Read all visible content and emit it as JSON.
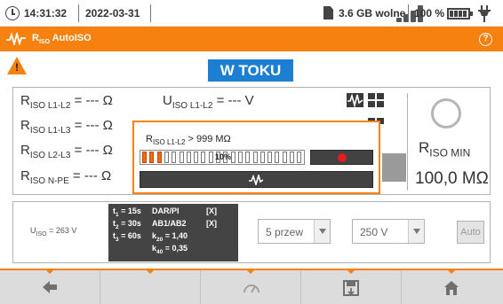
{
  "status_bar": {
    "time": "14:31:32",
    "date": "2022-03-31",
    "storage": "3.6 GB wolne",
    "battery": "100 %"
  },
  "title_bar": {
    "title_main": "R",
    "title_sub": "ISO",
    "title_rest": " AutoISO"
  },
  "status": {
    "label": "W TOKU"
  },
  "measurements": [
    {
      "r_main": "R",
      "r_sub": "ISO L1-L2",
      "r_value": " = --- Ω",
      "u_main": "U",
      "u_sub": "ISO L1-L2",
      "u_value": " = --- V"
    },
    {
      "r_main": "R",
      "r_sub": "ISO L1-L3",
      "r_value": " = --- Ω"
    },
    {
      "r_main": "R",
      "r_sub": "ISO L2-L3",
      "r_value": " = --- Ω"
    },
    {
      "r_main": "R",
      "r_sub": "ISO N-PE",
      "r_value": " = --- Ω"
    }
  ],
  "result": {
    "label_main": "R",
    "label_sub": "ISO MIN",
    "value": "100,0 MΩ"
  },
  "popup": {
    "reading_main": "R",
    "reading_sub": "ISO L1-L2",
    "reading_value": " > 999 MΩ",
    "progress_label": "10%",
    "progress": 0.1
  },
  "settings": {
    "uiso_main": "U",
    "uiso_sub": "ISO",
    "uiso_value": " = 263 V",
    "t1_main": "t",
    "t1_sub": "1",
    "t1_value": " = 15s",
    "t2_main": "t",
    "t2_sub": "2",
    "t2_value": " = 30s",
    "t3_main": "t",
    "t3_sub": "3",
    "t3_value": " = 60s",
    "dar_pi": "DAR/PI",
    "dar_flag": "[X]",
    "ab": "AB1/AB2",
    "ab_flag": "[X]",
    "k20_main": "k",
    "k20_sub": "20",
    "k20_value": " = 1,40",
    "k40_main": "k",
    "k40_sub": "40",
    "k40_value": " = 0,35",
    "wires_select": "5 przew",
    "voltage_select": "250 V",
    "auto_button": "Auto"
  },
  "toolbar": {
    "buttons": [
      "back-icon",
      "empty",
      "gauge-icon",
      "save-icon",
      "home-icon"
    ]
  },
  "colors": {
    "accent": "#f7810e",
    "badge": "#1d7fd2",
    "stop": "#e21e1e"
  }
}
